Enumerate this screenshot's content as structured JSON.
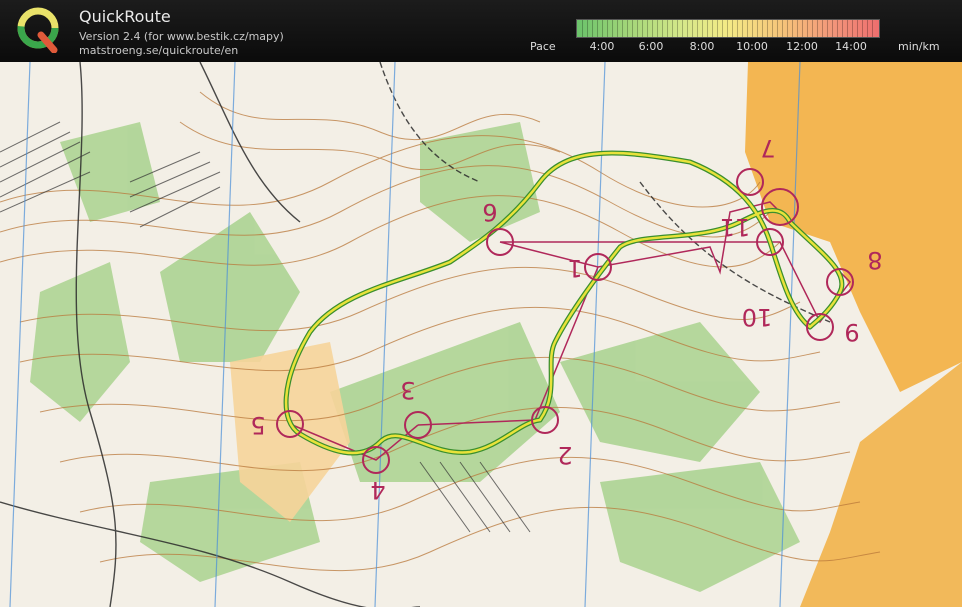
{
  "app": {
    "title": "QuickRoute",
    "version": "Version 2.4  (for www.bestik.cz/mapy)",
    "url": "matstroeng.se/quickroute/en"
  },
  "pace_scale": {
    "label": "Pace",
    "unit": "min/km",
    "ticks": [
      "4:00",
      "6:00",
      "8:00",
      "10:00",
      "12:00",
      "14:00"
    ]
  },
  "map": {
    "controls": [
      {
        "number": "1"
      },
      {
        "number": "2"
      },
      {
        "number": "3"
      },
      {
        "number": "4"
      },
      {
        "number": "5"
      },
      {
        "number": "6"
      },
      {
        "number": "7"
      },
      {
        "number": "8"
      },
      {
        "number": "9"
      },
      {
        "number": "10"
      },
      {
        "number": "11"
      }
    ]
  },
  "colors": {
    "course": "#b0285a",
    "route_fast": "#3a8f2e",
    "route_slow": "#e8e23a",
    "open_land": "#f2b24a",
    "forest_green": "#8fc77a"
  }
}
